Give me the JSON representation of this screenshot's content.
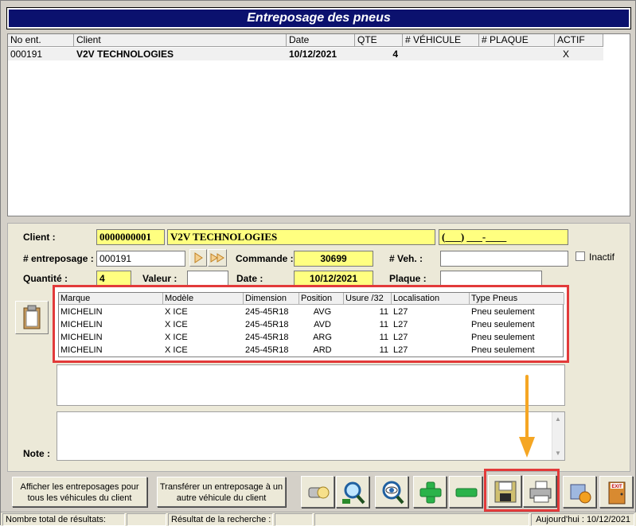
{
  "title": "Entreposage des pneus",
  "grid": {
    "columns": [
      "No ent.",
      "Client",
      "Date",
      "QTE",
      "# VÉHICULE",
      "# PLAQUE",
      "ACTIF"
    ],
    "rows": [
      {
        "no": "000191",
        "client": "V2V TECHNOLOGIES",
        "date": "10/12/2021",
        "qte": "4",
        "vehicule": "",
        "plaque": "",
        "actif": "X"
      }
    ]
  },
  "form": {
    "client_label": "Client :",
    "client_code": "0000000001",
    "client_name": "V2V TECHNOLOGIES",
    "client_phone": "(___) ___-____",
    "entreposage_label": "# entreposage :",
    "entreposage_value": "000191",
    "commande_label": "Commande :",
    "commande_value": "30699",
    "veh_label": "# Veh. :",
    "veh_value": "",
    "inactif_label": "Inactif",
    "quantite_label": "Quantité :",
    "quantite_value": "4",
    "valeur_label": "Valeur :",
    "valeur_value": "",
    "date_label": "Date :",
    "date_value": "10/12/2021",
    "plaque_label": "Plaque :",
    "plaque_value": "",
    "note_label": "Note :"
  },
  "tires": {
    "columns": [
      "Marque",
      "Modèle",
      "Dimension",
      "Position",
      "Usure /32",
      "Localisation",
      "Type Pneus"
    ],
    "rows": [
      [
        "MICHELIN",
        "X ICE",
        "245-45R18",
        "AVG",
        "11",
        "L27",
        "Pneu seulement"
      ],
      [
        "MICHELIN",
        "X ICE",
        "245-45R18",
        "AVD",
        "11",
        "L27",
        "Pneu seulement"
      ],
      [
        "MICHELIN",
        "X ICE",
        "245-45R18",
        "ARG",
        "11",
        "L27",
        "Pneu seulement"
      ],
      [
        "MICHELIN",
        "X ICE",
        "245-45R18",
        "ARD",
        "11",
        "L27",
        "Pneu seulement"
      ]
    ]
  },
  "buttons": {
    "show_all": "Afficher les entreposages pour tous les véhicules du client",
    "transfer": "Transférer un entreposage à un autre véhicule du client"
  },
  "status": {
    "total": "Nombre total de résultats:",
    "search": "Résultat de la recherche :",
    "today": "Aujourd'hui : 10/12/2021"
  },
  "colors": {
    "title_bg": "#0b116e",
    "highlight": "#e23a3a",
    "arrow": "#f5a623",
    "field_yellow": "#ffff80"
  }
}
